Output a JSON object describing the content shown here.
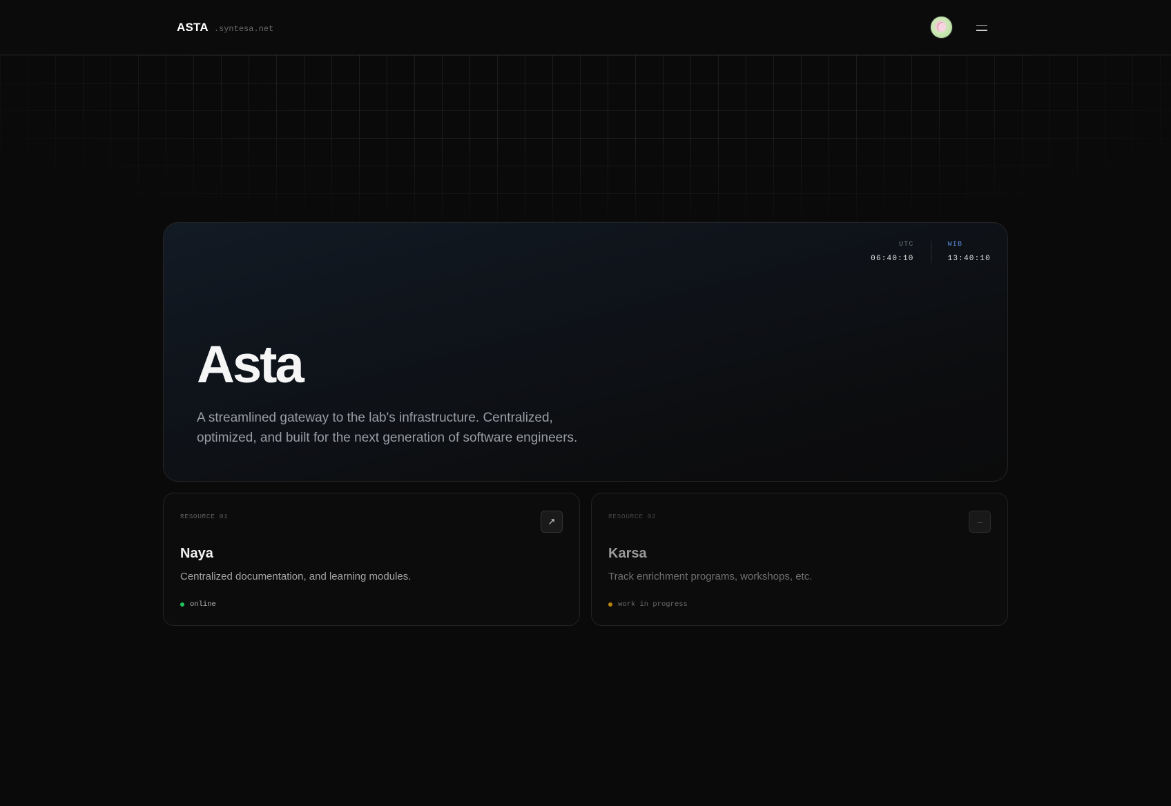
{
  "header": {
    "brand_name": "ASTA",
    "brand_domain": ".syntesa.net"
  },
  "hero": {
    "clock": {
      "utc_label": "UTC",
      "utc_time": "06:40:10",
      "wib_label": "WIB",
      "wib_time": "13:40:10"
    },
    "title": "Asta",
    "description": "A streamlined gateway to the lab's infrastructure. Centralized, optimized, and built for the next generation of software engineers."
  },
  "resources": [
    {
      "tag": "RESOURCE 01",
      "title": "Naya",
      "description": "Centralized documentation, and learning modules.",
      "status": "online",
      "status_color": "#22c55e",
      "action_icon": "arrow-up-right-icon",
      "action_glyph": "↗"
    },
    {
      "tag": "RESOURCE 02",
      "title": "Karsa",
      "description": "Track enrichment programs, workshops, etc.",
      "status": "work in progress",
      "status_color": "#b8860b",
      "action_icon": "dash-icon",
      "action_glyph": "–"
    }
  ],
  "colors": {
    "background": "#0a0a0a",
    "accent": "#5b8de0"
  }
}
